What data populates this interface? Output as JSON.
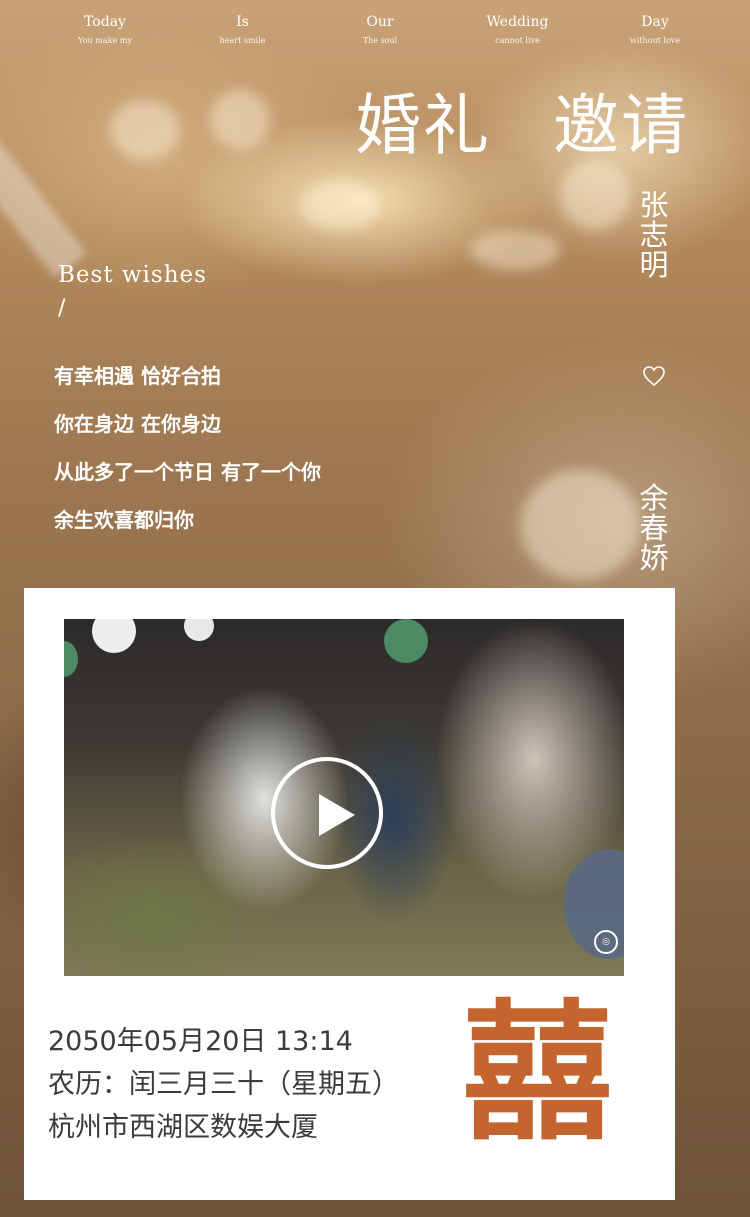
{
  "nav": [
    {
      "word": "Today",
      "sub": "You make my"
    },
    {
      "word": "Is",
      "sub": "heart smile"
    },
    {
      "word": "Our",
      "sub": "The soul"
    },
    {
      "word": "Wedding",
      "sub": "cannot live"
    },
    {
      "word": "Day",
      "sub": "without love"
    }
  ],
  "title": {
    "part1": "婚礼",
    "part2": "邀请"
  },
  "names": {
    "groom": "张志明",
    "bride": "余春娇"
  },
  "best_wishes": "Best wishes",
  "slash": "/",
  "poem": [
    "有幸相遇 恰好合拍",
    "你在身边 在你身边",
    "从此多了一个节日 有了一个你",
    "余生欢喜都归你"
  ],
  "video": {
    "watermark_icon": "logo-circle-icon",
    "play_icon": "play-icon"
  },
  "details": {
    "datetime": "2050年05月20日 13:14",
    "lunar": "农历：闰三月三十（星期五）",
    "address": "杭州市西湖区数娱大厦"
  },
  "double_happiness": "囍",
  "colors": {
    "accent": "#c4642e",
    "text": "#3b3b3b"
  }
}
